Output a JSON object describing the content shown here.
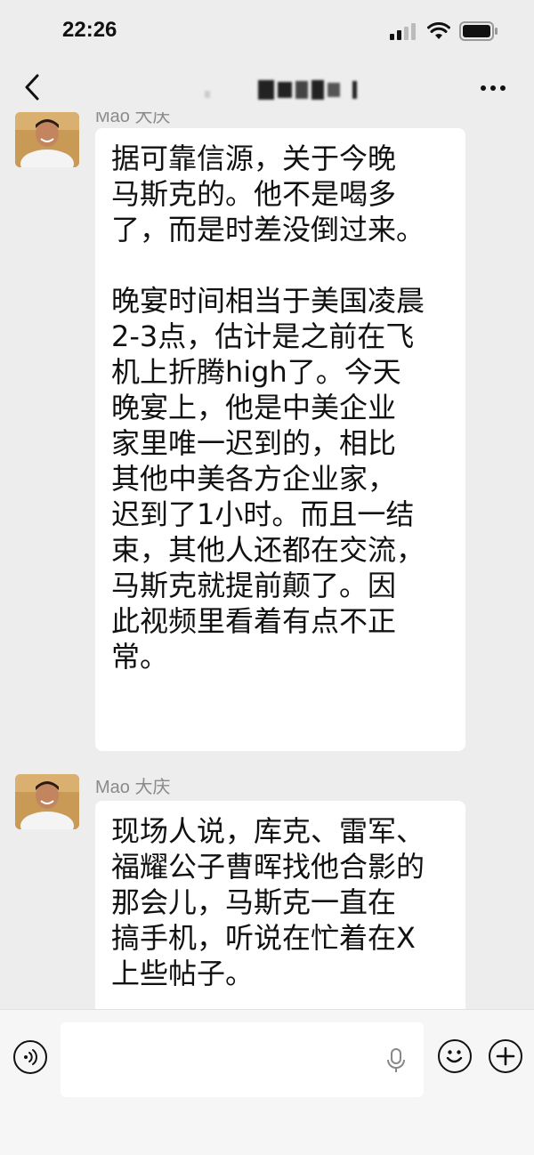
{
  "status_bar": {
    "time": "22:26",
    "icons": [
      "signal-icon",
      "wifi-icon",
      "battery-icon"
    ]
  },
  "nav": {
    "back_icon": "chevron-left-icon",
    "more_icon": "more-dots-icon"
  },
  "messages": [
    {
      "sender": "Mao 大庆",
      "text": "据可靠信源，关于今晚\n马斯克的。他不是喝多\n了，而是时差没倒过来。\n\n晚宴时间相当于美国凌晨\n2-3点，估计是之前在飞\n机上折腾high了。今天\n晚宴上，他是中美企业\n家里唯一迟到的，相比\n其他中美各方企业家，\n迟到了1小时。而且一结\n束，其他人还都在交流，\n马斯克就提前颠了。因\n此视频里看着有点不正\n常。"
    },
    {
      "sender": "Mao 大庆",
      "text": "现场人说，库克、雷军、\n福耀公子曹晖找他合影的\n那会儿，马斯克一直在\n搞手机，听说在忙着在X\n上些帖子。"
    }
  ],
  "input_bar": {
    "voice_icon": "voice-icon",
    "mic_icon": "microphone-icon",
    "emoji_icon": "emoji-icon",
    "plus_icon": "plus-icon"
  }
}
